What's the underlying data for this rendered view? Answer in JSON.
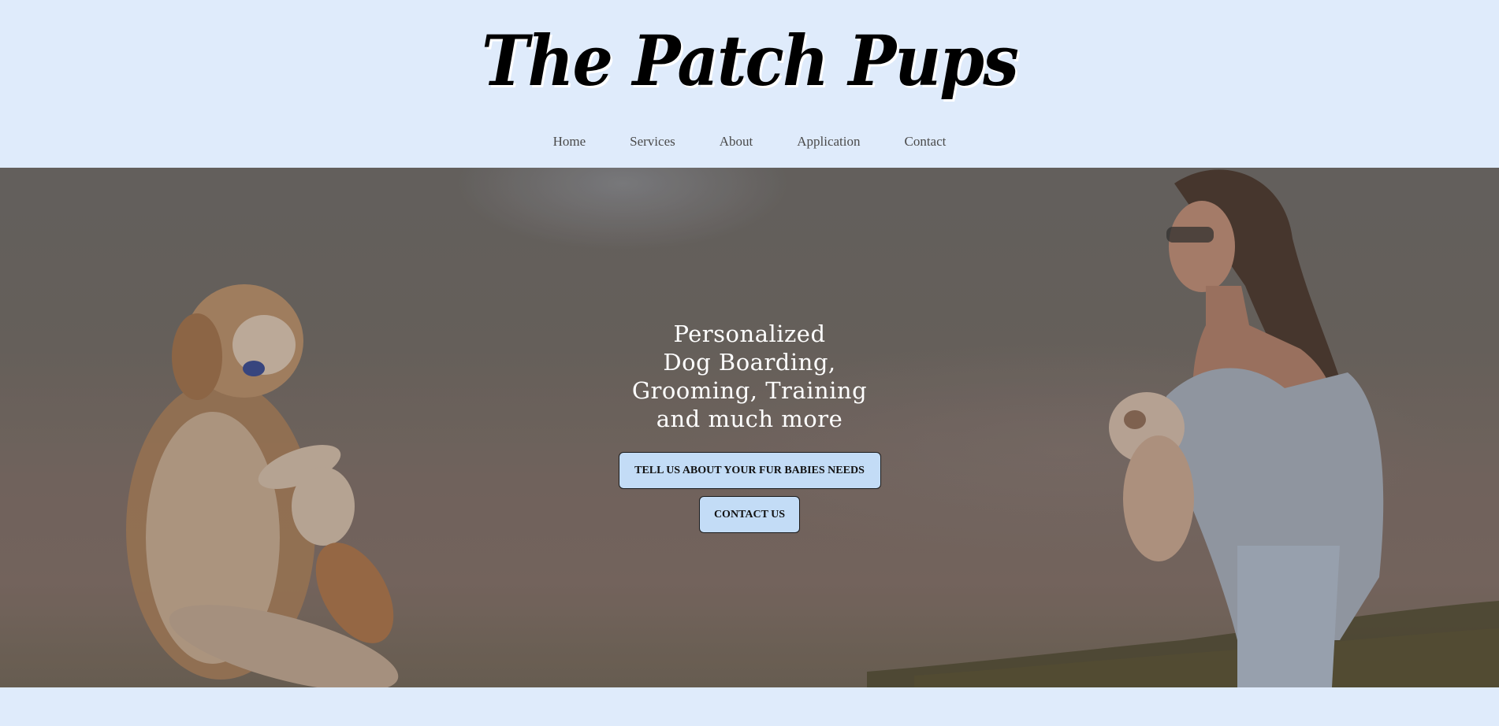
{
  "site": {
    "title": "The Patch Pups"
  },
  "nav": {
    "items": [
      {
        "label": "Home"
      },
      {
        "label": "Services"
      },
      {
        "label": "About"
      },
      {
        "label": "Application"
      },
      {
        "label": "Contact"
      }
    ]
  },
  "hero": {
    "heading_lines": [
      "Personalized",
      "Dog Boarding,",
      "Grooming, Training",
      "and much more"
    ],
    "primary_button": "TELL US ABOUT YOUR FUR BABIES NEEDS",
    "secondary_button": "CONTACT US"
  },
  "colors": {
    "page_background": "#dfebfb",
    "button_background": "#c3dcf6",
    "hero_text": "#ffffff",
    "nav_text": "#4a4a4a"
  },
  "icons": {
    "hero_image": "dog-and-woman-photo"
  }
}
